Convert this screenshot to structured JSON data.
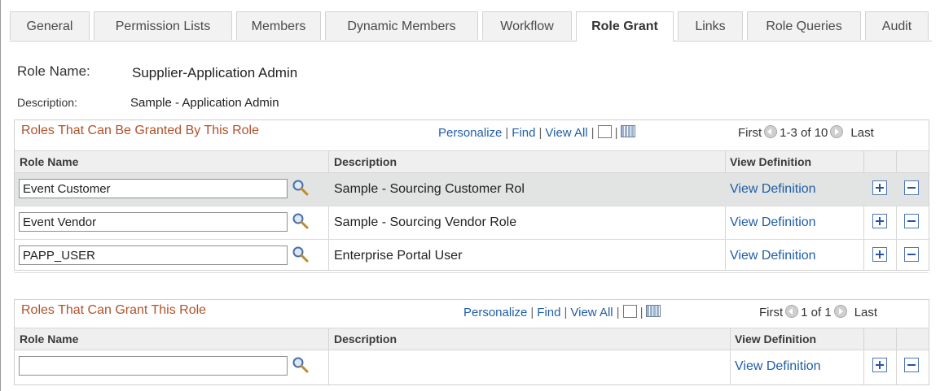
{
  "tabs": [
    "General",
    "Permission Lists",
    "Members",
    "Dynamic Members",
    "Workflow",
    "Role Grant",
    "Links",
    "Role Queries",
    "Audit"
  ],
  "active_tab": "Role Grant",
  "role": {
    "name_label": "Role Name:",
    "name_value": "Supplier-Application Admin",
    "desc_label": "Description:",
    "desc_value": "Sample - Application Admin"
  },
  "grid1": {
    "title": "Roles That Can Be Granted By This Role",
    "personalize": "Personalize",
    "find": "Find",
    "view_all": "View All",
    "first": "First",
    "range": "1-3 of 10",
    "last": "Last",
    "col_role": "Role Name",
    "col_desc": "Description",
    "col_view": "View Definition",
    "rows": [
      {
        "role": "Event Customer",
        "desc": "Sample - Sourcing Customer Rol",
        "link": "View Definition"
      },
      {
        "role": "Event Vendor",
        "desc": "Sample - Sourcing Vendor Role",
        "link": "View Definition"
      },
      {
        "role": "PAPP_USER",
        "desc": "Enterprise Portal User",
        "link": "View Definition"
      }
    ]
  },
  "grid2": {
    "title": "Roles That Can Grant This Role",
    "personalize": "Personalize",
    "find": "Find",
    "view_all": "View All",
    "first": "First",
    "range": "1 of 1",
    "last": "Last",
    "col_role": "Role Name",
    "col_desc": "Description",
    "col_view": "View Definition",
    "rows": [
      {
        "role": "",
        "desc": "",
        "link": "View Definition"
      }
    ]
  },
  "colors": {
    "title": "#b1522a",
    "link": "#1f5ea8",
    "selected_row": "#e1e4e2"
  }
}
